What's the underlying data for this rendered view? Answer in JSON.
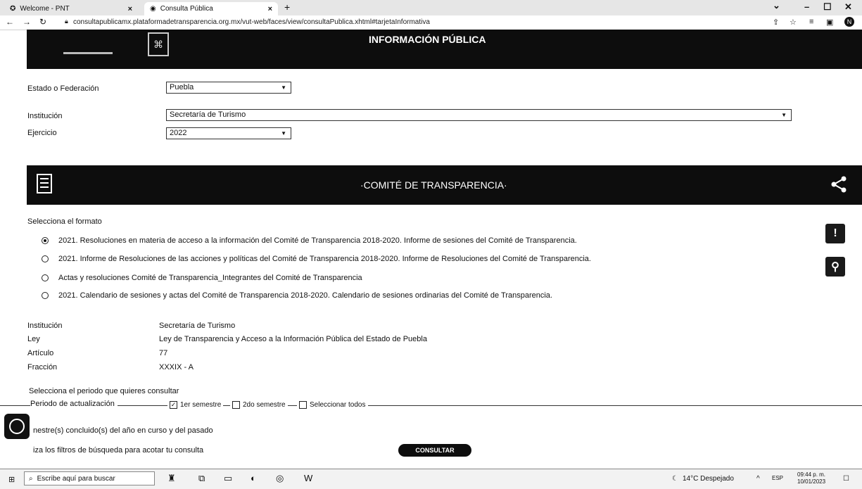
{
  "browser": {
    "tabs": [
      {
        "title": "Welcome - PNT",
        "close": "×"
      },
      {
        "title": "Consulta Pública",
        "close": "×"
      }
    ],
    "new_tab": "+",
    "url": "consultapublicamx.plataformadetransparencia.org.mx/vut-web/faces/view/consultaPublica.xhtml#tarjetaInformativa",
    "profile_initial": "N",
    "window_controls": {
      "minimize": "–",
      "maximize": "☐",
      "close": "✕"
    }
  },
  "header": {
    "title": "INFORMACIÓN PÚBLICA"
  },
  "filters": {
    "estado_label": "Estado o Federación",
    "estado_value": "Puebla",
    "institucion_label": "Institución",
    "institucion_value": "Secretaría de Turismo",
    "ejercicio_label": "Ejercicio",
    "ejercicio_value": "2022"
  },
  "banner": {
    "title": "·COMITÉ DE TRANSPARENCIA·"
  },
  "formats": {
    "prompt": "Selecciona el formato",
    "options": [
      {
        "label": "2021. Resoluciones en materia de acceso a la información del Comité de Transparencia 2018-2020. Informe de sesiones del Comité de Transparencia.",
        "selected": true
      },
      {
        "label": "2021. Informe de Resoluciones de las acciones y políticas del Comité de Transparencia 2018-2020. Informe de Resoluciones del Comité de Transparencia.",
        "selected": false
      },
      {
        "label": "Actas y resoluciones Comité de Transparencia_Integrantes del Comité de Transparencia",
        "selected": false
      },
      {
        "label": "2021. Calendario de sesiones y actas del Comité de Transparencia 2018-2020. Calendario de sesiones ordinarias del Comité de Transparencia.",
        "selected": false
      }
    ]
  },
  "info": {
    "institucion_label": "Institución",
    "institucion_value": "Secretaría de Turismo",
    "ley_label": "Ley",
    "ley_value": "Ley de Transparencia y Acceso a la Información Pública del Estado de Puebla",
    "articulo_label": "Artículo",
    "articulo_value": "77",
    "fraccion_label": "Fracción",
    "fraccion_value": "XXXIX - A"
  },
  "period": {
    "question": "Selecciona el periodo que quieres consultar",
    "legend": "Periodo de actualización",
    "options": [
      {
        "label": "1er semestre",
        "checked": true
      },
      {
        "label": "2do semestre",
        "checked": false
      },
      {
        "label": "Seleccionar todos",
        "checked": false
      }
    ],
    "note1": "nestre(s) concluido(s) del año en curso y del pasado",
    "note2": "iza los filtros de búsqueda para acotar tu consulta",
    "consult_button": "CONSULTAR"
  },
  "taskbar": {
    "search_placeholder": "Escribe aquí para buscar",
    "weather": "14°C Despejado",
    "language": "ESP",
    "time": "09:44 p. m.",
    "date": "10/01/2023"
  },
  "icons": {
    "browser": [
      "back-icon",
      "forward-icon",
      "reload-icon",
      "lock-icon",
      "share-page-icon",
      "star-icon",
      "extensions-icon",
      "sidebar-icon"
    ],
    "page": [
      "document-edit-icon",
      "share-icon",
      "alert-icon",
      "search-wrench-icon",
      "accessibility-icon"
    ]
  }
}
